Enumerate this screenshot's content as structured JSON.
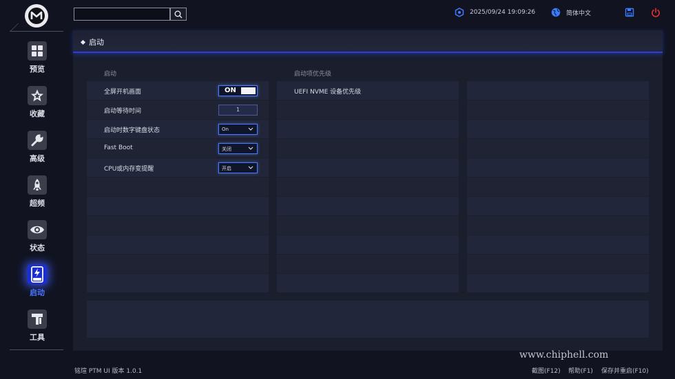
{
  "app": {
    "version_text": "铭瑄 PTM UI 版本 1.0.1"
  },
  "sidebar": {
    "items": [
      {
        "label": "预览",
        "icon": "grid-icon"
      },
      {
        "label": "收藏",
        "icon": "star-icon"
      },
      {
        "label": "高级",
        "icon": "wrench-icon"
      },
      {
        "label": "超频",
        "icon": "rocket-icon"
      },
      {
        "label": "状态",
        "icon": "eye-icon"
      },
      {
        "label": "启动",
        "icon": "ssd-icon"
      },
      {
        "label": "工具",
        "icon": "tools-icon"
      }
    ],
    "active_index": 5
  },
  "topbar": {
    "search_placeholder": "",
    "datetime": "2025/09/24 19:09:26",
    "language": "简体中文"
  },
  "section": {
    "title": "启动"
  },
  "boot_settings": {
    "heading": "启动",
    "rows": [
      {
        "label": "全屏开机画面",
        "control": "toggle",
        "value": "ON"
      },
      {
        "label": "启动等待时间",
        "control": "number",
        "value": "1"
      },
      {
        "label": "启动时数字键盘状态",
        "control": "select",
        "value": "On"
      },
      {
        "label": "Fast Boot",
        "control": "select",
        "value": "关闭"
      },
      {
        "label": "CPU或内存变提醒",
        "control": "select",
        "value": "开启"
      }
    ]
  },
  "boot_priority": {
    "heading": "启动项优先级",
    "items": [
      "UEFI NVME 设备优先级"
    ]
  },
  "footer": {
    "screenshot": "截图(F12)",
    "help": "帮助(F1)",
    "save_restart": "保存并重启(F10)"
  },
  "watermark": "www.chiphell.com",
  "colors": {
    "accent": "#2b3fd8",
    "active_nav": "#1b2ed6",
    "power": "#e03030",
    "save": "#3a7cff"
  }
}
